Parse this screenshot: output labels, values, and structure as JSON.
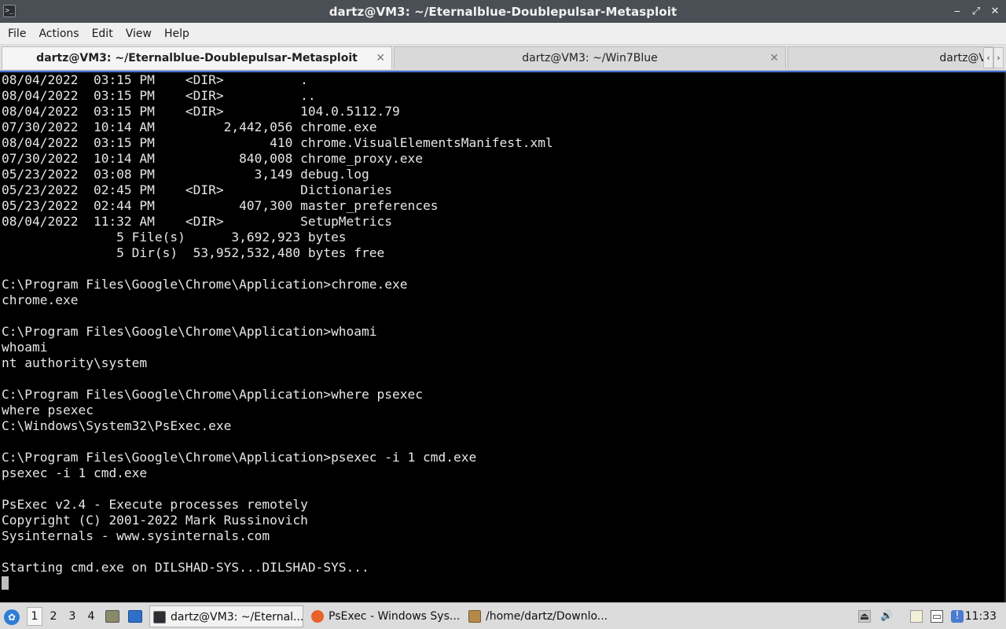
{
  "window": {
    "title": "dartz@VM3: ~/Eternalblue-Doublepulsar-Metasploit",
    "controls": {
      "minimize": "‒",
      "maximize": "⤢",
      "close": "✕"
    }
  },
  "menu": [
    "File",
    "Actions",
    "Edit",
    "View",
    "Help"
  ],
  "tabs": [
    {
      "label": "dartz@VM3: ~/Eternalblue-Doublepulsar-Metasploit",
      "active": true
    },
    {
      "label": "dartz@VM3: ~/Win7Blue",
      "active": false
    },
    {
      "label": "dartz@V",
      "active": false
    }
  ],
  "tab_close_glyph": "✕",
  "tab_scroll": {
    "left": "‹",
    "right": "›"
  },
  "terminal": {
    "lines": [
      "08/04/2022  03:15 PM    <DIR>          .",
      "08/04/2022  03:15 PM    <DIR>          ..",
      "08/04/2022  03:15 PM    <DIR>          104.0.5112.79",
      "07/30/2022  10:14 AM         2,442,056 chrome.exe",
      "08/04/2022  03:15 PM               410 chrome.VisualElementsManifest.xml",
      "07/30/2022  10:14 AM           840,008 chrome_proxy.exe",
      "05/23/2022  03:08 PM             3,149 debug.log",
      "05/23/2022  02:45 PM    <DIR>          Dictionaries",
      "05/23/2022  02:44 PM           407,300 master_preferences",
      "08/04/2022  11:32 AM    <DIR>          SetupMetrics",
      "               5 File(s)      3,692,923 bytes",
      "               5 Dir(s)  53,952,532,480 bytes free",
      "",
      "C:\\Program Files\\Google\\Chrome\\Application>chrome.exe",
      "chrome.exe",
      "",
      "C:\\Program Files\\Google\\Chrome\\Application>whoami",
      "whoami",
      "nt authority\\system",
      "",
      "C:\\Program Files\\Google\\Chrome\\Application>where psexec",
      "where psexec",
      "C:\\Windows\\System32\\PsExec.exe",
      "",
      "C:\\Program Files\\Google\\Chrome\\Application>psexec -i 1 cmd.exe",
      "psexec -i 1 cmd.exe",
      "",
      "PsExec v2.4 - Execute processes remotely",
      "Copyright (C) 2001-2022 Mark Russinovich",
      "Sysinternals - www.sysinternals.com",
      "",
      "Starting cmd.exe on DILSHAD-SYS...DILSHAD-SYS..."
    ]
  },
  "taskbar": {
    "desktops": [
      "1",
      "2",
      "3",
      "4"
    ],
    "active_desktop": "1",
    "tasks": [
      {
        "label": "dartz@VM3: ~/Eternal...",
        "icon": "terminal-icon",
        "active": true
      },
      {
        "label": "PsExec - Windows Sys...",
        "icon": "firefox-icon",
        "active": false
      },
      {
        "label": "/home/dartz/Downlo...",
        "icon": "archive-icon",
        "active": false
      }
    ],
    "tray_icons": [
      "eject-icon",
      "volume-icon",
      "clipboard-icon",
      "network-icon",
      "notification-icon"
    ],
    "clock": "11:33"
  },
  "colors": {
    "accent": "#3d6fd1",
    "titlebar": "#4a4f55",
    "terminal_bg": "#000000",
    "terminal_fg": "#e6e6e6"
  }
}
